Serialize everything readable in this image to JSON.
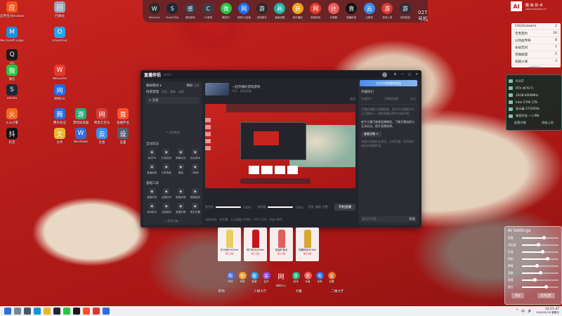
{
  "desktop_left": [
    {
      "label": "应用宝(Windows版)",
      "icon": "app-store-icon",
      "color": "#f2561f"
    },
    {
      "label": "回收站",
      "icon": "recycle-bin-icon",
      "color": "#9aa6b8"
    },
    {
      "label": "Microsoft Edge",
      "icon": "edge-icon",
      "color": "#1f8fd6"
    },
    {
      "label": "OneDrive",
      "icon": "onedrive-icon",
      "color": "#2aa3e6"
    },
    {
      "label": "QQ",
      "icon": "qq-icon",
      "color": "#1a1a1a"
    },
    {
      "label": "微信",
      "icon": "wechat-icon",
      "color": "#28c445"
    },
    {
      "label": "WeGame",
      "icon": "wegame-icon",
      "color": "#e23b2e"
    },
    {
      "label": "Steam",
      "icon": "steam-icon",
      "color": "#1b2838"
    },
    {
      "label": "网易UU",
      "icon": "uu-icon",
      "color": "#1e6ef0"
    },
    {
      "label": "腾讯会议",
      "icon": "meeting-icon",
      "color": "#2a6de0"
    },
    {
      "label": "游戏加速器",
      "icon": "accelerator-icon",
      "color": "#23b07c"
    },
    {
      "label": "网易云音乐",
      "icon": "music-icon",
      "color": "#d43c33"
    },
    {
      "label": "直播伴侣",
      "icon": "broadcast-icon",
      "color": "#ff4f2a"
    },
    {
      "label": "火山引擎",
      "icon": "engine-icon",
      "color": "#f06a1d"
    },
    {
      "label": "Windows",
      "icon": "windows-icon",
      "color": "#2f6fd6"
    },
    {
      "label": "云盘",
      "icon": "cloud-icon",
      "color": "#3a8ee6"
    },
    {
      "label": "设置",
      "icon": "settings-icon",
      "color": "#566070"
    },
    {
      "label": "文件",
      "icon": "folder-icon",
      "color": "#e8b730"
    },
    {
      "label": "抖音",
      "icon": "tiktok-icon",
      "color": "#111111"
    }
  ],
  "top_dock": [
    {
      "label": "WeGame",
      "icon": "wegame-icon",
      "color": "#2a2a2a"
    },
    {
      "label": "Steam平台",
      "icon": "steam-icon",
      "color": "#1b2838"
    },
    {
      "label": "感知游戏",
      "icon": "game-icon",
      "color": "#3b3d4a"
    },
    {
      "label": "CS游戏",
      "icon": "cs-icon",
      "color": "#3b3d4a"
    },
    {
      "label": "微信PC",
      "icon": "wechat-icon",
      "color": "#28c445"
    },
    {
      "label": "网易UU加速",
      "icon": "uu-icon",
      "color": "#1e6ef0"
    },
    {
      "label": "游戏助手",
      "icon": "assistant-icon",
      "color": "#2a2a2a"
    },
    {
      "label": "画面设置",
      "icon": "display-icon",
      "color": "#22b1a5"
    },
    {
      "label": "音乐播放",
      "icon": "music-icon",
      "color": "#f0a020"
    },
    {
      "label": "网易游戏",
      "icon": "netease-icon",
      "color": "#e23b2e"
    },
    {
      "label": "计算器",
      "icon": "calculator-icon",
      "color": "#e85b5b"
    },
    {
      "label": "直播伴侣",
      "icon": "tiktok-icon",
      "color": "#111111"
    },
    {
      "label": "云服务",
      "icon": "cloud-icon",
      "color": "#3a8ee6"
    },
    {
      "label": "游戏上线",
      "icon": "online-icon",
      "color": "#d43c33"
    },
    {
      "label": "游戏性能",
      "icon": "performance-icon",
      "color": "#2b2d36"
    }
  ],
  "top_dock_time": "027号机",
  "brand": {
    "logo": "AI",
    "name": "酷·南·技·术",
    "sub": "www.example.cn"
  },
  "stats_panel": {
    "rows": [
      {
        "label": "CSGO(steam)",
        "value": "2"
      },
      {
        "label": "无畏契约",
        "value": "16"
      },
      {
        "label": "以热血传奇",
        "value": "8"
      },
      {
        "label": "永劫无间",
        "value": "7"
      },
      {
        "label": "英雄联盟",
        "value": "5"
      },
      {
        "label": "穿越火线",
        "value": "3"
      }
    ],
    "more": "查看更多 >"
  },
  "system_panel": {
    "rows": [
      {
        "label": "P/1ST",
        "icon": "cpu-icon"
      },
      {
        "label": "RTX 4070 Ti",
        "icon": "gpu-icon"
      },
      {
        "label": "32GB 6000MHz",
        "icon": "memory-icon"
      },
      {
        "label": "Intel Z790 1TB",
        "icon": "disk-icon"
      },
      {
        "label": "显示器 27/240Hz",
        "icon": "monitor-icon"
      },
      {
        "label": "电竞外设 一二/88",
        "icon": "peripheral-icon"
      }
    ],
    "buttons": [
      "配置详情",
      "网络上网"
    ]
  },
  "main_window": {
    "app_title": "直播伴侣",
    "version": "v9.8.7",
    "left_header": "横屏模式 ▾",
    "left_tabs": [
      "横屏",
      "竖屏"
    ],
    "scene_label": "场景管理",
    "scene_tabs": [
      "游戏",
      "摄像",
      "桌面"
    ],
    "scene_item": "全屏",
    "add_source": "+ 添加素材",
    "interact_title": "互动玩法",
    "interact_tools": [
      "连线PK",
      "礼物连线",
      "弹幕玩法",
      "互动游戏",
      "直播抽奖",
      "分享电脑",
      "福袋",
      "小程序"
    ],
    "base_title": "基础工具",
    "base_tools": [
      "直播任务",
      "主播任务",
      "直播录屏",
      "直播回放",
      "游戏助手",
      "主播提效",
      "直播拍照",
      "更多设置"
    ],
    "more_tools": "— 更多功能 —",
    "stream_title": "一起开播的游戏游戏",
    "stream_sub": "CS2 · 游戏热场",
    "stream_badge": "画质",
    "stream_btns": [
      "开播模式",
      "分享"
    ],
    "right_panel_title": "开播指引",
    "banner": "点击开始直播领权益",
    "guide_tabs": [
      "在线用户",
      "开播前准备",
      "玩法"
    ],
    "guide_text_1": "开播前请确认直播画面、麦克风与摄像头均已正确接入，避免直播过程中出现异常。",
    "guide_text_2": "新手主播可查看直播教程，了解开播流程与互动玩法，提升直播效果。",
    "guide_link": "查看详情 >",
    "guide_text_3": "请遵守直播社区规范，文明开播，共同维护良好的直播环境。",
    "chat_placeholder": "说点什么吧…",
    "send_btn": "发送",
    "volume_label": "麦克风",
    "volume_value": "100%",
    "volume2_label": "扬声器",
    "volume2_value": "100%",
    "bottom_tools": [
      "音效",
      "美颜",
      "设置"
    ],
    "start_btn": "开始直播",
    "status_text": "当前状态：未开播 · 上行速度 0 KB/s · CPU 12% · 内存 46%"
  },
  "products": [
    {
      "name": "东方树叶500ml",
      "price": "¥5.00",
      "color": "#e8d060"
    },
    {
      "name": "可口可乐500ml",
      "price": "¥3.50",
      "color": "#c8141c"
    },
    {
      "name": "怡宝矿泉水",
      "price": "¥2.00",
      "color": "#e06060"
    },
    {
      "name": "东鹏特饮500ml",
      "price": "¥6.00",
      "color": "#d8a830"
    }
  ],
  "bottom_dock": [
    {
      "label": "购物",
      "icon": "shopping-icon",
      "color": "#4a6de0"
    },
    {
      "label": "拍照",
      "icon": "camera-icon",
      "color": "#e8a030"
    },
    {
      "label": "客服",
      "icon": "service-icon",
      "color": "#2a9de0"
    },
    {
      "label": "会员",
      "icon": "member-icon",
      "color": "#8a4ae0"
    },
    {
      "label": "网吧中心",
      "icon": "center-logo-icon",
      "color": "#b01818"
    },
    {
      "label": "游戏",
      "icon": "game-icon",
      "color": "#23b07c"
    },
    {
      "label": "充值",
      "icon": "recharge-icon",
      "color": "#e85b5b"
    },
    {
      "label": "电竞",
      "icon": "esports-icon",
      "color": "#2a6de0"
    },
    {
      "label": "设置",
      "icon": "settings-icon",
      "color": "#e86a30"
    }
  ],
  "bottom_tags": [
    "购物",
    "三楼大厅",
    "点餐",
    "二楼大厅"
  ],
  "ai_settings": {
    "title": "AI Settings",
    "rows": [
      "亮度",
      "对比度",
      "色温",
      "锐化",
      "降噪",
      "音量",
      "游戏",
      "超分"
    ],
    "levels": [
      0.6,
      0.45,
      0.55,
      0.7,
      0.4,
      0.5,
      0.35,
      0.65
    ],
    "buttons": [
      "保存",
      "应用设置"
    ]
  },
  "taskbar": {
    "time": "14:21:47",
    "date": "2024/02/18 星期日",
    "apps": [
      {
        "icon": "start-icon",
        "color": "#2f6fd6"
      },
      {
        "icon": "search-icon",
        "color": "#7a8596"
      },
      {
        "icon": "taskview-icon",
        "color": "#4a5566"
      },
      {
        "icon": "edge-icon",
        "color": "#1f8fd6"
      },
      {
        "icon": "folder-icon",
        "color": "#e8b730"
      },
      {
        "icon": "steam-icon",
        "color": "#1b2838"
      },
      {
        "icon": "wechat-icon",
        "color": "#28c445"
      },
      {
        "icon": "qq-icon",
        "color": "#1a1a1a"
      },
      {
        "icon": "broadcast-icon",
        "color": "#ff4f2a"
      },
      {
        "icon": "music-icon",
        "color": "#d43c33"
      },
      {
        "icon": "store-icon",
        "color": "#2a6de0"
      }
    ],
    "tray": [
      "^",
      "中",
      "🔊"
    ]
  }
}
